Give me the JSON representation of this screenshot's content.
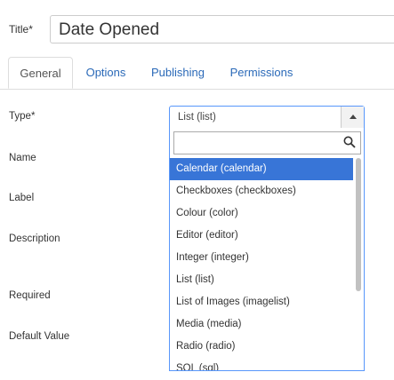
{
  "title": {
    "label": "Title",
    "required_mark": "*",
    "value": "Date Opened"
  },
  "tabs": [
    {
      "label": "General",
      "active": true
    },
    {
      "label": "Options",
      "active": false
    },
    {
      "label": "Publishing",
      "active": false
    },
    {
      "label": "Permissions",
      "active": false
    }
  ],
  "form": {
    "type_label": "Type",
    "type_required_mark": "*",
    "name_label": "Name",
    "label_label": "Label",
    "description_label": "Description",
    "required_label": "Required",
    "default_value_label": "Default Value"
  },
  "type_select": {
    "selected": "List (list)",
    "search_value": "",
    "options": [
      "Calendar (calendar)",
      "Checkboxes (checkboxes)",
      "Colour (color)",
      "Editor (editor)",
      "Integer (integer)",
      "List (list)",
      "List of Images (imagelist)",
      "Media (media)",
      "Radio (radio)",
      "SQL (sql)"
    ],
    "highlighted_index": 0
  },
  "colors": {
    "accent": "#3875d7",
    "link": "#2a69b8",
    "focus_border": "#5897fb"
  }
}
